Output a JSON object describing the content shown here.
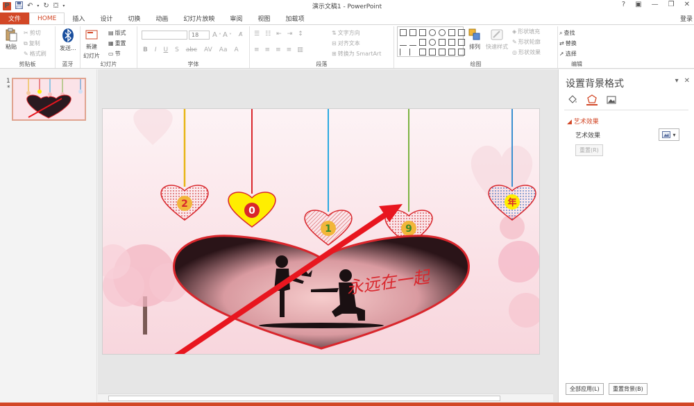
{
  "titlebar": {
    "app_logo": "P",
    "doc_title": "演示文稿1 - PowerPoint",
    "help": "?",
    "restore_icon": "restore-ribbon-icon",
    "minimize": "—",
    "maximize": "❐",
    "close": "✕"
  },
  "tabs": {
    "file": "文件",
    "home": "HOME",
    "insert": "插入",
    "design": "设计",
    "transitions": "切换",
    "animations": "动画",
    "slideshow": "幻灯片放映",
    "review": "审阅",
    "view": "视图",
    "addins": "加载项",
    "signin": "登录"
  },
  "ribbon": {
    "clipboard": {
      "paste": "粘贴",
      "cut": "剪切",
      "copy": "复制",
      "format_painter": "格式刷",
      "label": "剪贴板"
    },
    "bluetooth": {
      "send": "发送...",
      "label": "蓝牙"
    },
    "slides": {
      "new_slide": "新建",
      "new_slide2": "幻灯片",
      "layout": "版式",
      "reset": "重置",
      "section": "节",
      "label": "幻灯片"
    },
    "font": {
      "font_size": "18",
      "label": "字体"
    },
    "paragraph": {
      "text_direction": "文字方向",
      "align_text": "对齐文本",
      "smartart": "转换为 SmartArt",
      "label": "段落"
    },
    "drawing": {
      "arrange": "排列",
      "quick_styles": "快速样式",
      "shape_fill": "形状填充",
      "shape_outline": "形状轮廓",
      "shape_effects": "形状效果",
      "label": "绘图"
    },
    "editing": {
      "find": "查找",
      "replace": "替换",
      "select": "选择",
      "label": "编辑"
    }
  },
  "thumbnails": [
    {
      "number": "1",
      "star": "*"
    }
  ],
  "slide": {
    "hearts": [
      "2",
      "0",
      "1",
      "9",
      "年"
    ],
    "caption": "永远在一起",
    "colors": {
      "bg": "#fdeef1",
      "heart_frame": "#d9262c",
      "arrow": "#e8161f"
    }
  },
  "format_pane": {
    "title": "设置背景格式",
    "section": "艺术效果",
    "art_effects_label": "艺术效果",
    "reset_btn": "重置(R)",
    "apply_all_btn": "全部应用(L)",
    "reset_bg_btn": "重置背景(B)"
  }
}
